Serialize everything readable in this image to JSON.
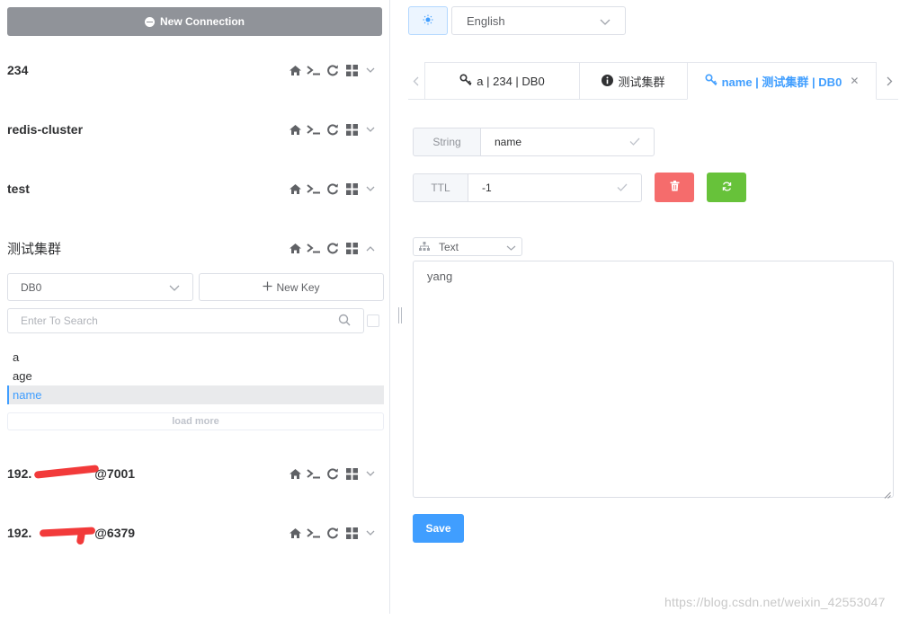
{
  "sidebar": {
    "new_connection_label": "New Connection",
    "connections": [
      {
        "name": "234",
        "expanded": false
      },
      {
        "name": "redis-cluster",
        "expanded": false
      },
      {
        "name": "test",
        "expanded": false
      },
      {
        "name": "测试集群",
        "expanded": true
      },
      {
        "name_start": "192.",
        "name_end": "@7001",
        "expanded": false,
        "redacted": true
      },
      {
        "name_start": "192.",
        "name_end": "@6379",
        "expanded": false,
        "redacted": true
      }
    ],
    "db_select": {
      "value": "DB0"
    },
    "new_key_label": "New Key",
    "search": {
      "placeholder": "Enter To Search"
    },
    "keys": [
      "a",
      "age",
      "name"
    ],
    "active_key": "name",
    "load_more_label": "load more"
  },
  "topbar": {
    "language": "English"
  },
  "tabs": [
    {
      "label": "a | 234 | DB0",
      "icon": "key-icon"
    },
    {
      "label": "测试集群",
      "icon": "info-icon"
    },
    {
      "label": "name | 测试集群 | DB0",
      "icon": "key-icon",
      "active": true
    }
  ],
  "key_detail": {
    "type_label": "String",
    "key_name": "name",
    "ttl_label": "TTL",
    "ttl_value": "-1",
    "format": "Text",
    "value": "yang",
    "save_label": "Save"
  },
  "watermark": "https://blog.csdn.net/weixin_42553047",
  "colors": {
    "primary": "#409eff",
    "danger": "#f56c6c",
    "success": "#67c23a",
    "new_connection_bg": "#909399"
  }
}
